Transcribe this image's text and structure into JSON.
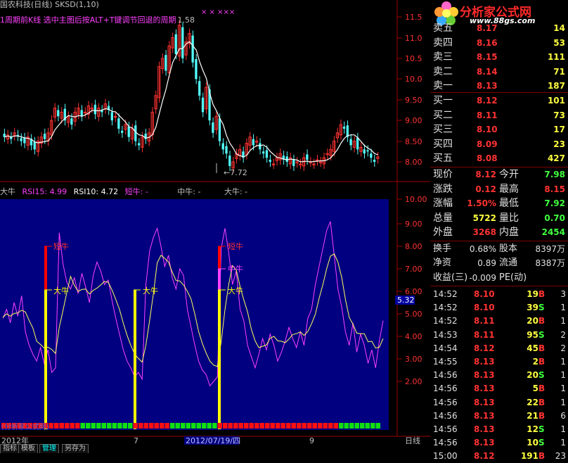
{
  "header": {
    "stock": "国农科技(日线)",
    "indicator": "SKSD(1,10)",
    "hint": "1周期前K线  选中主图后按ALT+T键调节回退的周期",
    "price_tag": "1.58",
    "marks": "×  ×  ×××",
    "low_label": "7.72"
  },
  "price_axis": [
    "11.5",
    "11.0",
    "10.5",
    "10.0",
    "9.50",
    "9.00",
    "8.50",
    "8.00"
  ],
  "indicator_header": {
    "dn": "大牛",
    "rsi15": "RSI15: 4.99",
    "rsi10": "RSI10: 4.72",
    "short": "短牛: -",
    "mid": "中牛: -",
    "big": "大牛: -"
  },
  "ind_axis": [
    "10.00",
    "9.00",
    "8.00",
    "7.00",
    "6.00",
    "5.00",
    "4.00",
    "3.00",
    "2.00"
  ],
  "ind_current": "5.32",
  "signal_labels": {
    "short": "短牛",
    "mid": "中牛",
    "big": "大牛"
  },
  "watermark": "(分析家公式网)",
  "date_axis": {
    "left": "2012年",
    "d7": "7",
    "date": "2012/07/19/四",
    "d9": "9",
    "period": "日线"
  },
  "bottom_tabs": [
    "指标",
    "模板",
    "管理",
    "另存为"
  ],
  "logo": {
    "text": "分析家公式网",
    "url": "www.88gs.com"
  },
  "colors": {
    "up": "#ff3232",
    "down": "#54ffff",
    "bg2": "#000080",
    "yellow": "#ffff00",
    "magenta": "#ff40ff"
  },
  "order_book": [
    {
      "label": "卖五",
      "price": "8.17",
      "vol": "14"
    },
    {
      "label": "卖四",
      "price": "8.16",
      "vol": "53"
    },
    {
      "label": "卖三",
      "price": "8.15",
      "vol": "111"
    },
    {
      "label": "卖二",
      "price": "8.14",
      "vol": "71"
    },
    {
      "label": "卖一",
      "price": "8.13",
      "vol": "187"
    },
    {
      "label": "买一",
      "price": "8.12",
      "vol": "101"
    },
    {
      "label": "买二",
      "price": "8.11",
      "vol": "73"
    },
    {
      "label": "买三",
      "price": "8.10",
      "vol": "17"
    },
    {
      "label": "买四",
      "price": "8.09",
      "vol": "23"
    },
    {
      "label": "买五",
      "price": "8.08",
      "vol": "427"
    }
  ],
  "quote": [
    {
      "l1": "现价",
      "v1": "8.12",
      "l2": "今开",
      "v2": "7.98"
    },
    {
      "l1": "涨跌",
      "v1": "0.12",
      "l2": "最高",
      "v2": "8.15"
    },
    {
      "l1": "涨幅",
      "v1": "1.50%",
      "l2": "最低",
      "v2": "7.92"
    },
    {
      "l1": "总量",
      "v1": "5722",
      "l2": "量比",
      "v2": "0.70"
    },
    {
      "l1": "外盘",
      "v1": "3268",
      "l2": "内盘",
      "v2": "2454"
    }
  ],
  "fund": [
    {
      "l1": "换手",
      "v1": "0.68%",
      "l2": "股本",
      "v2": "8397万"
    },
    {
      "l1": "净资",
      "v1": "0.89",
      "l2": "流通",
      "v2": "8387万"
    },
    {
      "l1": "收益(三)",
      "v1": "-0.009",
      "l2": "PE(动)",
      "v2": ""
    }
  ],
  "ticks": [
    {
      "t": "14:52",
      "p": "8.10",
      "v": "19",
      "s": "B",
      "n": "3"
    },
    {
      "t": "14:52",
      "p": "8.10",
      "v": "39",
      "s": "S",
      "n": "1"
    },
    {
      "t": "14:52",
      "p": "8.11",
      "v": "20",
      "s": "B",
      "n": "1"
    },
    {
      "t": "14:53",
      "p": "8.11",
      "v": "95",
      "s": "S",
      "n": "2"
    },
    {
      "t": "14:54",
      "p": "8.12",
      "v": "45",
      "s": "B",
      "n": "2"
    },
    {
      "t": "14:55",
      "p": "8.13",
      "v": "2",
      "s": "B",
      "n": "1"
    },
    {
      "t": "14:56",
      "p": "8.13",
      "v": "20",
      "s": "S",
      "n": "1"
    },
    {
      "t": "14:56",
      "p": "8.13",
      "v": "5",
      "s": "B",
      "n": "1"
    },
    {
      "t": "14:56",
      "p": "8.13",
      "v": "22",
      "s": "B",
      "n": "1"
    },
    {
      "t": "14:56",
      "p": "8.13",
      "v": "21",
      "s": "B",
      "n": "6"
    },
    {
      "t": "14:56",
      "p": "8.13",
      "v": "12",
      "s": "S",
      "n": "1"
    },
    {
      "t": "14:56",
      "p": "8.13",
      "v": "10",
      "s": "S",
      "n": "1"
    },
    {
      "t": "15:00",
      "p": "8.12",
      "v": "191",
      "s": "B",
      "n": "23"
    }
  ]
}
